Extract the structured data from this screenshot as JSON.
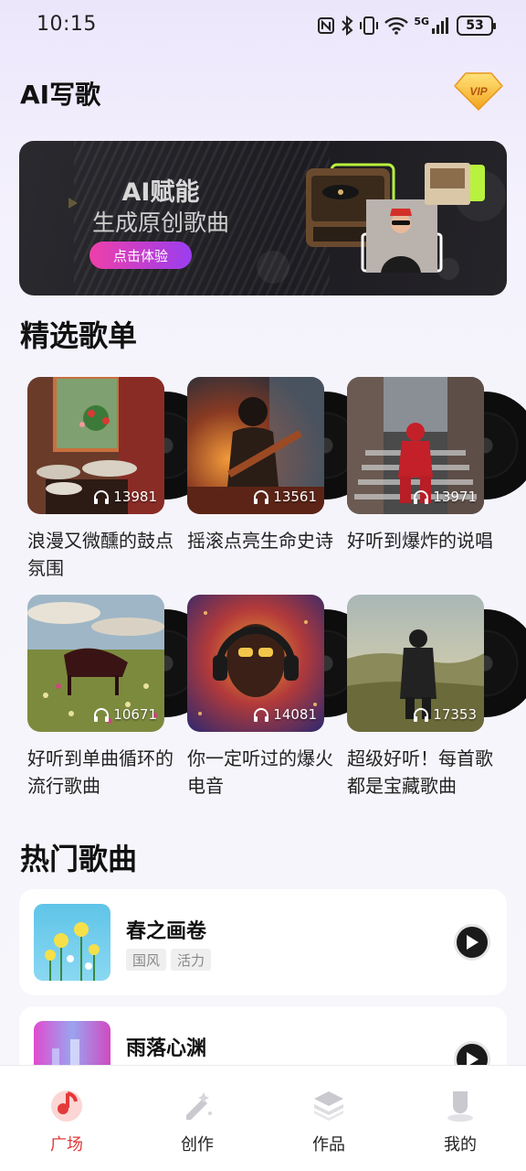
{
  "status_bar": {
    "time": "10:15",
    "network": "5G",
    "battery": "53"
  },
  "header": {
    "title": "AI写歌",
    "vip_label": "VIP"
  },
  "banner": {
    "title": "AI赋能",
    "subtitle": "生成原创歌曲",
    "cta": "点击体验"
  },
  "featured": {
    "title": "精选歌单",
    "playlists": [
      {
        "name": "浪漫又微醺的鼓点氛围",
        "plays": "13981"
      },
      {
        "name": "摇滚点亮生命史诗",
        "plays": "13561"
      },
      {
        "name": "好听到爆炸的说唱",
        "plays": "13971"
      },
      {
        "name": "好听到单曲循环的流行歌曲",
        "plays": "10671"
      },
      {
        "name": "你一定听过的爆火电音",
        "plays": "14081"
      },
      {
        "name": "超级好听！每首歌都是宝藏歌曲",
        "plays": "17353"
      }
    ]
  },
  "hot_songs": {
    "title": "热门歌曲",
    "songs": [
      {
        "title": "春之画卷",
        "tags": [
          "国风",
          "活力"
        ]
      },
      {
        "title": "雨落心渊",
        "tags": []
      }
    ]
  },
  "bottom_nav": {
    "items": [
      {
        "label": "广场",
        "icon": "music-note-icon",
        "active": true
      },
      {
        "label": "创作",
        "icon": "magic-pen-icon",
        "active": false
      },
      {
        "label": "作品",
        "icon": "layers-icon",
        "active": false
      },
      {
        "label": "我的",
        "icon": "profile-icon",
        "active": false
      }
    ]
  },
  "colors": {
    "accent": "#e33a3a",
    "cta_start": "#ef3fa9",
    "cta_end": "#9a3ef0"
  }
}
